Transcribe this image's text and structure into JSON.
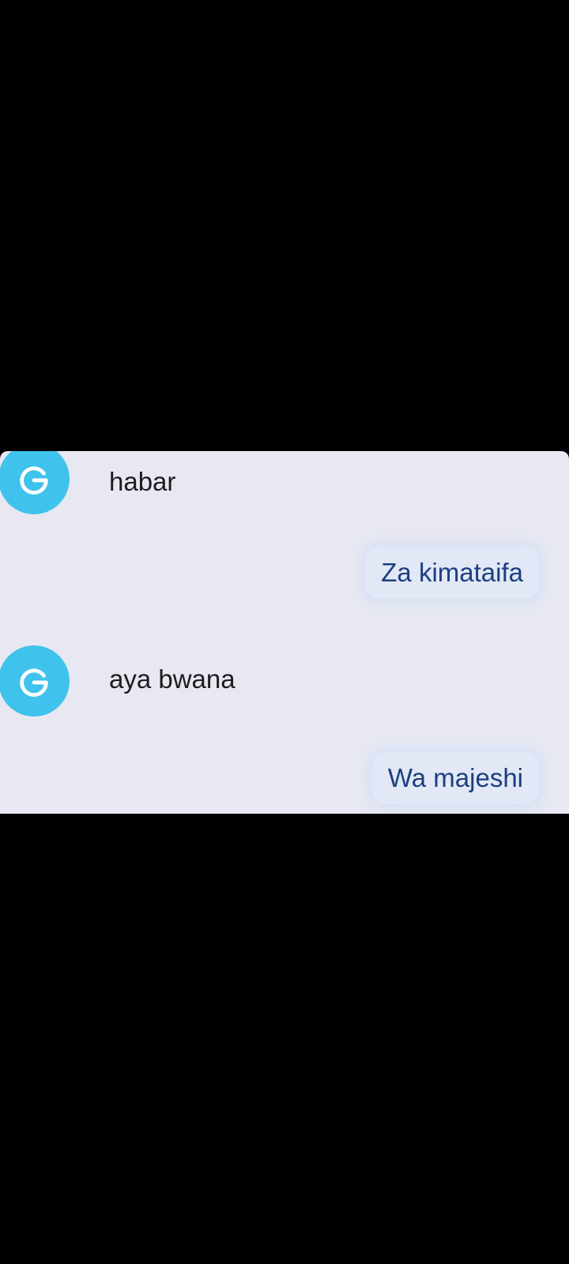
{
  "conversation": {
    "messages": [
      {
        "direction": "incoming",
        "avatar_letter": "G",
        "avatar_icon": "google-g-icon",
        "text": "habar"
      },
      {
        "direction": "outgoing",
        "text": "Za kimataifa"
      },
      {
        "direction": "incoming",
        "avatar_letter": "G",
        "avatar_icon": "google-g-icon",
        "text": "aya bwana"
      },
      {
        "direction": "outgoing",
        "text": "Wa majeshi"
      }
    ]
  },
  "colors": {
    "background": "#000000",
    "chat_background": "#e7e8f1",
    "avatar": "#3fc3ec",
    "incoming_text": "#1d1d1f",
    "outgoing_text": "#1b3f80",
    "outgoing_bubble": "#e3e8f6"
  }
}
